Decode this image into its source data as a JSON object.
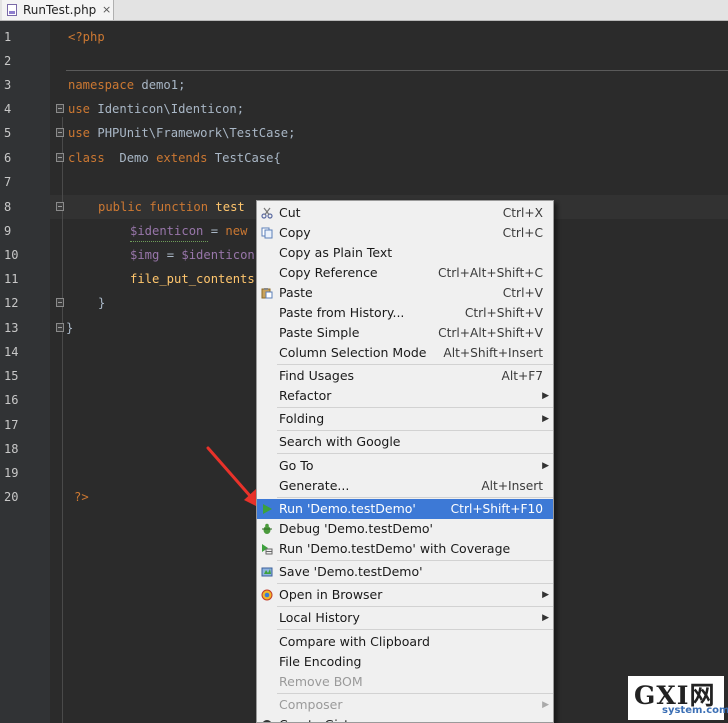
{
  "tab": {
    "filename": "RunTest.php",
    "close": "×"
  },
  "line_numbers": [
    "1",
    "2",
    "3",
    "4",
    "5",
    "6",
    "7",
    "8",
    "9",
    "10",
    "11",
    "12",
    "13",
    "14",
    "15",
    "16",
    "17",
    "18",
    "19",
    "20"
  ],
  "code": {
    "open_tag": "<?php",
    "l3_kw": "namespace",
    "l3_rest": " demo1;",
    "l4_kw": "use",
    "l4_rest": " Identicon\\Identicon;",
    "l5_kw": "use",
    "l5_rest": " PHPUnit\\Framework\\TestCase;",
    "l6_kw1": "class",
    "l6_name": "  Demo ",
    "l6_kw2": "extends",
    "l6_rest": " TestCase{",
    "l8_kw": "public function",
    "l8_rest": " test",
    "l9_var": "$identicon",
    "l9_rest": " = ",
    "l9_kw": "new",
    "l10_var": "$img",
    "l10_rest": " = ",
    "l10_var2": "$identicon",
    "l11_fn": "file_put_contents",
    "l12": "}",
    "l13": "}",
    "close_tag": "?>"
  },
  "menu": {
    "items": [
      {
        "label": "Cut",
        "shortcut": "Ctrl+X"
      },
      {
        "label": "Copy",
        "shortcut": "Ctrl+C"
      },
      {
        "label": "Copy as Plain Text",
        "shortcut": ""
      },
      {
        "label": "Copy Reference",
        "shortcut": "Ctrl+Alt+Shift+C"
      },
      {
        "label": "Paste",
        "shortcut": "Ctrl+V"
      },
      {
        "label": "Paste from History...",
        "shortcut": "Ctrl+Shift+V"
      },
      {
        "label": "Paste Simple",
        "shortcut": "Ctrl+Alt+Shift+V"
      },
      {
        "label": "Column Selection Mode",
        "shortcut": "Alt+Shift+Insert"
      },
      {
        "label": "Find Usages",
        "shortcut": "Alt+F7"
      },
      {
        "label": "Refactor",
        "shortcut": ""
      },
      {
        "label": "Folding",
        "shortcut": ""
      },
      {
        "label": "Search with Google",
        "shortcut": ""
      },
      {
        "label": "Go To",
        "shortcut": ""
      },
      {
        "label": "Generate...",
        "shortcut": "Alt+Insert"
      },
      {
        "label": "Run 'Demo.testDemo'",
        "shortcut": "Ctrl+Shift+F10"
      },
      {
        "label": "Debug 'Demo.testDemo'",
        "shortcut": ""
      },
      {
        "label": "Run 'Demo.testDemo' with Coverage",
        "shortcut": ""
      },
      {
        "label": "Save 'Demo.testDemo'",
        "shortcut": ""
      },
      {
        "label": "Open in Browser",
        "shortcut": ""
      },
      {
        "label": "Local History",
        "shortcut": ""
      },
      {
        "label": "Compare with Clipboard",
        "shortcut": ""
      },
      {
        "label": "File Encoding",
        "shortcut": ""
      },
      {
        "label": "Remove BOM",
        "shortcut": ""
      },
      {
        "label": "Composer",
        "shortcut": ""
      },
      {
        "label": "Create Gist...",
        "shortcut": ""
      }
    ],
    "selected": "Run 'Demo.testDemo'"
  },
  "watermark": {
    "brand": "GXI网",
    "domain": "system.com"
  },
  "colors": {
    "editor_bg": "#2b2b2b",
    "keyword": "#cc7832",
    "variable": "#9876aa",
    "function": "#ffc66d",
    "menu_bg": "#f0f0f0",
    "menu_selected": "#3d79d6",
    "arrow": "#e8322a"
  }
}
